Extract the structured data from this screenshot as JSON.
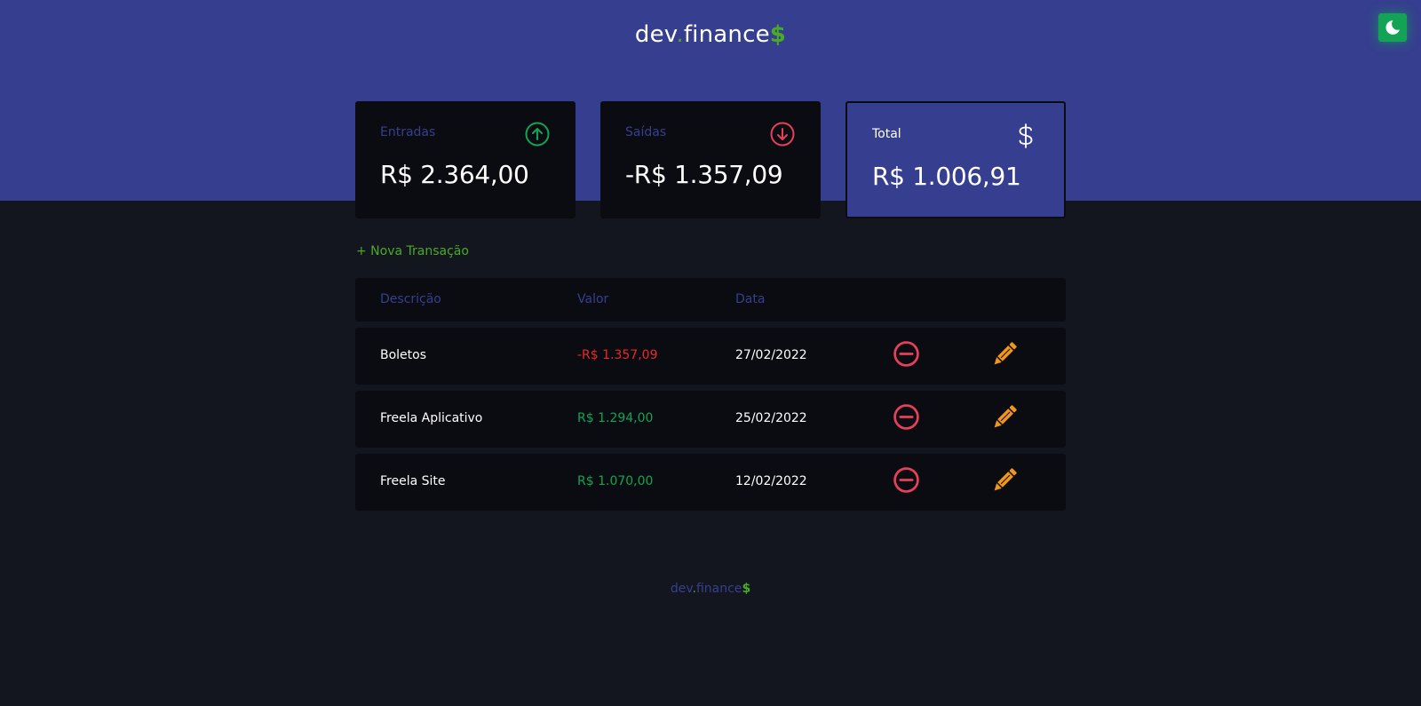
{
  "header": {
    "logo": {
      "prefix": "dev",
      "dot": ".",
      "name": "finance",
      "suffix": "$"
    }
  },
  "theme_toggle": {
    "icon": "moon-icon"
  },
  "summary": {
    "income": {
      "label": "Entradas",
      "value": "R$ 2.364,00",
      "icon": "arrow-up-circle-icon"
    },
    "expense": {
      "label": "Saídas",
      "value": "-R$ 1.357,09",
      "icon": "arrow-down-circle-icon"
    },
    "total": {
      "label": "Total",
      "value": "R$ 1.006,91",
      "icon": "dollar-sign-icon"
    }
  },
  "new_transaction_label": "+ Nova Transação",
  "table": {
    "headers": {
      "description": "Descrição",
      "amount": "Valor",
      "date": "Data"
    },
    "rows": [
      {
        "description": "Boletos",
        "amount": "-R$ 1.357,09",
        "date": "27/02/2022",
        "type": "expense"
      },
      {
        "description": "Freela Aplicativo",
        "amount": "R$ 1.294,00",
        "date": "25/02/2022",
        "type": "income"
      },
      {
        "description": "Freela Site",
        "amount": "R$ 1.070,00",
        "date": "12/02/2022",
        "type": "income"
      }
    ]
  },
  "footer": {
    "logo": {
      "prefix": "dev",
      "dot": ".",
      "name": "finance",
      "suffix": "$"
    }
  },
  "colors": {
    "brand": "#363f8f",
    "income": "#12a454",
    "expense": "#e92929",
    "accent": "#49aa26",
    "remove": "#e83f5b",
    "edit": "#f0961d",
    "background": "#14161f",
    "card": "#0b0c11"
  }
}
